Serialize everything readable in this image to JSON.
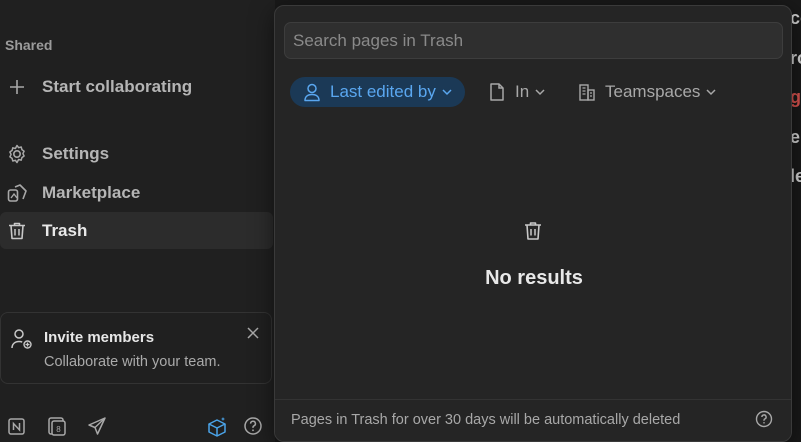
{
  "sidebar": {
    "section_label": "Shared",
    "items": [
      {
        "label": "Start collaborating",
        "icon": "plus-icon"
      },
      {
        "label": "Settings",
        "icon": "gear-icon"
      },
      {
        "label": "Marketplace",
        "icon": "marketplace-icon"
      },
      {
        "label": "Trash",
        "icon": "trash-icon",
        "active": true
      }
    ],
    "invite": {
      "title": "Invite members",
      "subtitle": "Collaborate with your team."
    },
    "bottom_icons": [
      "notion-icon",
      "calendar-icon",
      "send-icon",
      "gift-box-icon",
      "help-icon"
    ]
  },
  "background_fragments": [
    "co",
    "ro",
    "g",
    "e",
    "le"
  ],
  "trash_popup": {
    "search_placeholder": "Search pages in Trash",
    "filters": [
      {
        "label": "Last edited by",
        "icon": "person-icon",
        "active": true
      },
      {
        "label": "In",
        "icon": "page-icon",
        "active": false
      },
      {
        "label": "Teamspaces",
        "icon": "building-icon",
        "active": false
      }
    ],
    "empty_text": "No results",
    "footer_text": "Pages in Trash for over 30 days will be automatically deleted"
  },
  "colors": {
    "sidebar_bg": "#202020",
    "popup_bg": "#252525",
    "accent_blue": "#5aa7f0",
    "accent_blue_bg": "#1b3956",
    "fragment_red": "#d9534f"
  }
}
